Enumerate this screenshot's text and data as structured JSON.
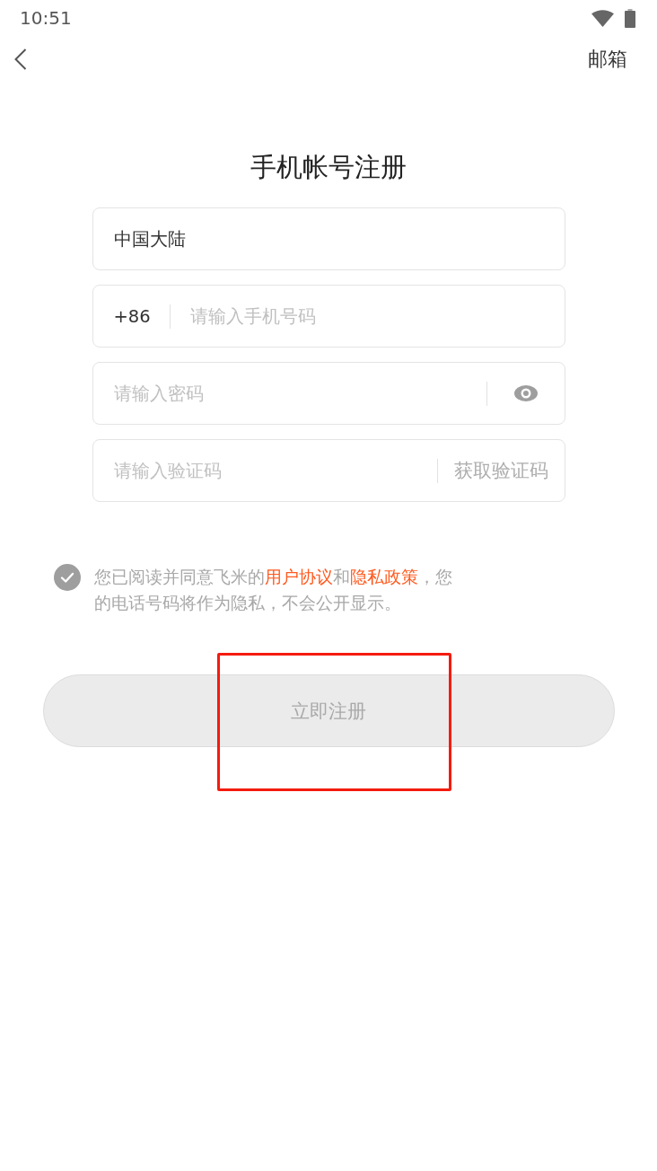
{
  "status_bar": {
    "time": "10:51"
  },
  "nav": {
    "right_link": "邮箱"
  },
  "title": "手机帐号注册",
  "fields": [
    {
      "kind": "select",
      "value": "中国大陆"
    },
    {
      "kind": "phone",
      "prefix": "+86",
      "placeholder": "请输入手机号码"
    },
    {
      "kind": "password",
      "placeholder": "请输入密码"
    },
    {
      "kind": "code",
      "placeholder": "请输入验证码",
      "action": "获取验证码"
    }
  ],
  "agreement": {
    "checked": true,
    "parts": [
      {
        "kind": "text",
        "text": "您已阅读并同意飞米的"
      },
      {
        "kind": "link",
        "text": "用户协议"
      },
      {
        "kind": "text",
        "text": "和"
      },
      {
        "kind": "link",
        "text": "隐私政策"
      },
      {
        "kind": "text",
        "text": "，您的电话号码将作为隐私，不会公开显示。"
      }
    ]
  },
  "register_button": {
    "label": "立即注册",
    "disabled": true,
    "highlighted": true
  }
}
